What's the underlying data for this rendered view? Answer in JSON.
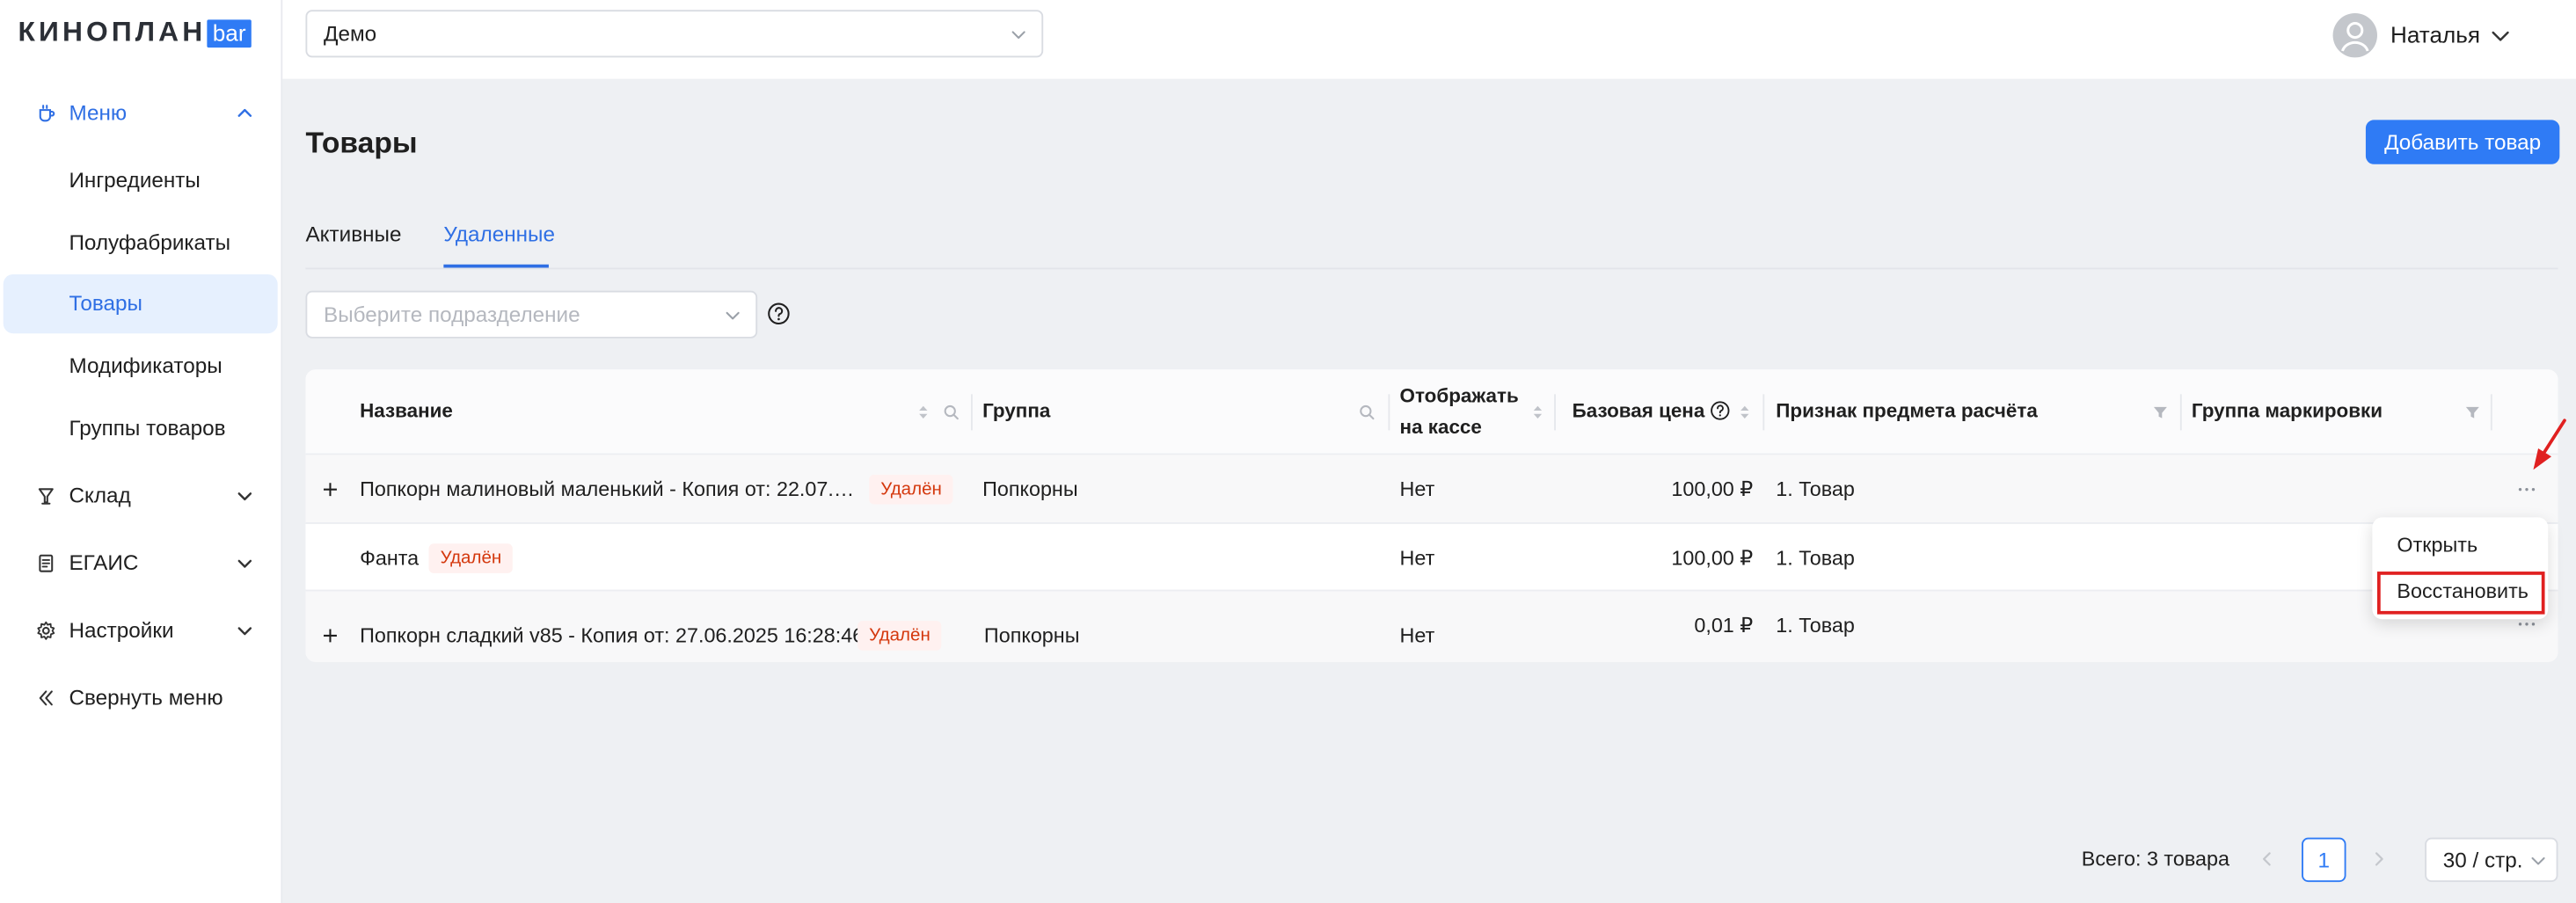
{
  "sidebar": {
    "logo_text": "КИНОПЛАН",
    "logo_badge": "bar",
    "menu_label": "Меню",
    "menu_items": [
      "Ингредиенты",
      "Полуфабрикаты",
      "Товары",
      "Модификаторы",
      "Группы товаров"
    ],
    "active_item": "Товары",
    "groups": [
      {
        "label": "Склад",
        "icon": "glass-icon"
      },
      {
        "label": "ЕГАИС",
        "icon": "document-icon"
      },
      {
        "label": "Настройки",
        "icon": "gear-icon"
      }
    ],
    "collapse_label": "Свернуть меню"
  },
  "header": {
    "venue_select_value": "Демо",
    "user_name": "Наталья"
  },
  "page": {
    "title": "Товары",
    "add_button": "Добавить товар",
    "tabs": [
      {
        "label": "Активные",
        "active": false
      },
      {
        "label": "Удаленные",
        "active": true
      }
    ],
    "division_placeholder": "Выберите подразделение"
  },
  "table": {
    "columns": [
      "Название",
      "Группа",
      "Отображать",
      "на кассе",
      "Базовая цена",
      "Признак предмета расчёта",
      "Группа маркировки"
    ],
    "deleted_tag": "Удалён",
    "rows": [
      {
        "expandable": true,
        "name": "Попкорн малиновый маленький - Копия от: 22.07.20…",
        "tag": "Удалён",
        "group": "Попкорны",
        "show_at_pos": "Нет",
        "price": "100,00 ₽",
        "payment_attr": "1. Товар",
        "mark_group": ""
      },
      {
        "expandable": false,
        "name": "Фанта",
        "tag": "Удалён",
        "group": "",
        "show_at_pos": "Нет",
        "price": "100,00 ₽",
        "payment_attr": "1. Товар",
        "mark_group": ""
      },
      {
        "expandable": true,
        "name": "Попкорн сладкий v85 - Копия от: 27.06.2025 16:28:46",
        "tag": "Удалён",
        "group": "Попкорны",
        "show_at_pos": "Нет",
        "price": "0,01 ₽",
        "payment_attr": "1. Товар",
        "mark_group": ""
      }
    ]
  },
  "row_menu": {
    "items": [
      "Открыть",
      "Восстановить"
    ],
    "highlighted": "Восстановить"
  },
  "pagination": {
    "total": "Всего: 3 товара",
    "current_page": "1",
    "page_size": "30 / стр."
  },
  "colors": {
    "accent": "#2f7bf5",
    "active_text": "#2f6fe4",
    "deleted_tag_text": "#d4380d",
    "deleted_tag_bg": "#fff1f0",
    "annotation": "#e02020"
  }
}
